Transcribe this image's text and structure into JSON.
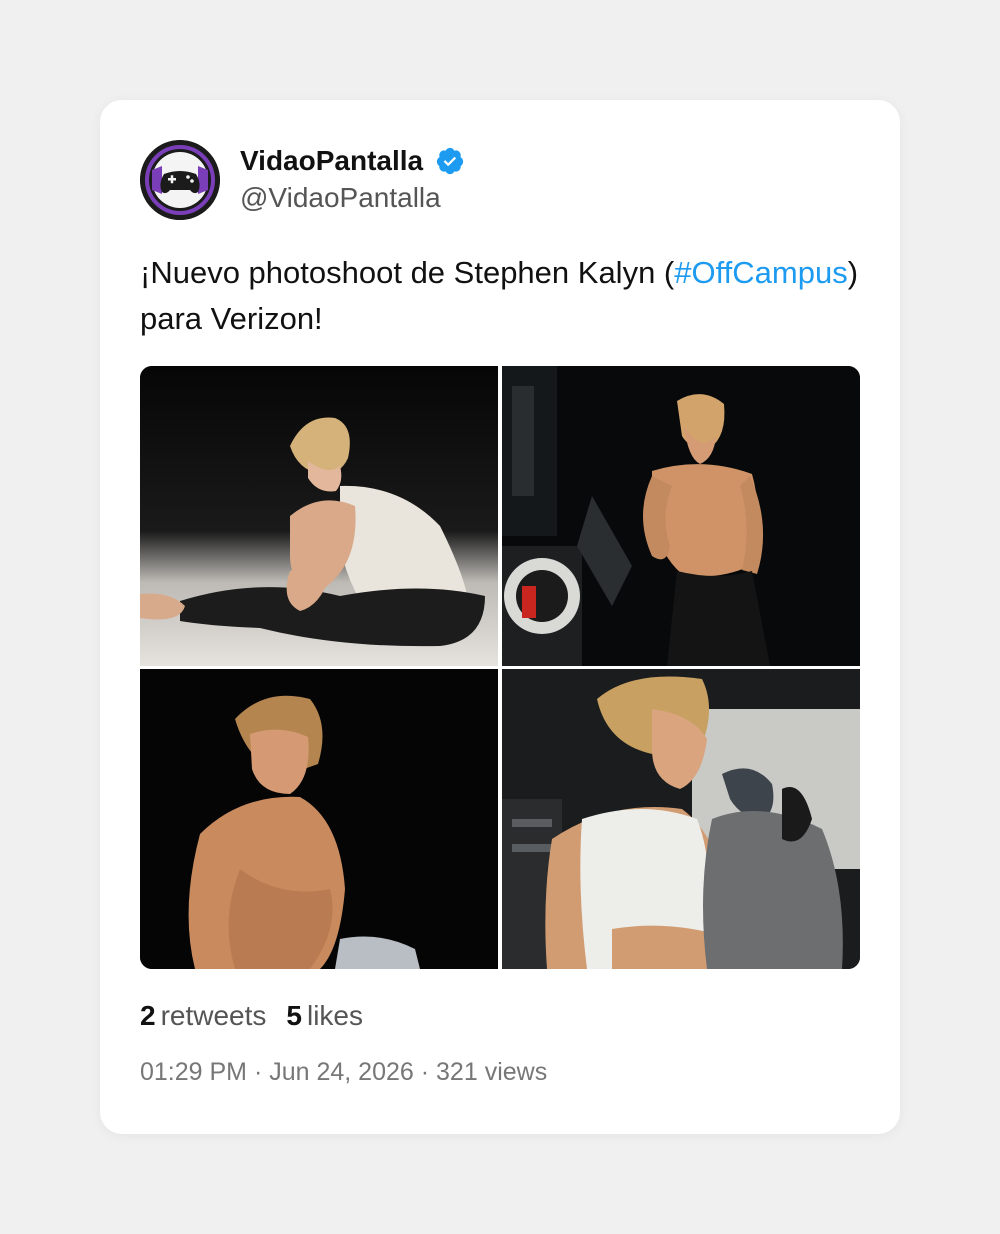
{
  "user": {
    "display_name": "VidaoPantalla",
    "handle": "@VidaoPantalla",
    "verified": true,
    "verified_color": "#1d9bf0",
    "avatar_icon": "gamepad-logo-icon"
  },
  "tweet": {
    "text_before": "¡Nuevo photoshoot de Stephen Kalyn (",
    "hashtag": "#OffCampus",
    "text_after": ") para Verizon!",
    "hashtag_color": "#1d9bf0"
  },
  "media": {
    "count": 4,
    "items": [
      {
        "name": "photo-1"
      },
      {
        "name": "photo-2"
      },
      {
        "name": "photo-3"
      },
      {
        "name": "photo-4"
      }
    ]
  },
  "stats": {
    "retweets_count": "2",
    "retweets_label": "retweets",
    "likes_count": "5",
    "likes_label": "likes"
  },
  "meta": {
    "time": "01:29 PM",
    "date": "Jun 24, 2026",
    "views": "321 views",
    "separator": " · "
  }
}
